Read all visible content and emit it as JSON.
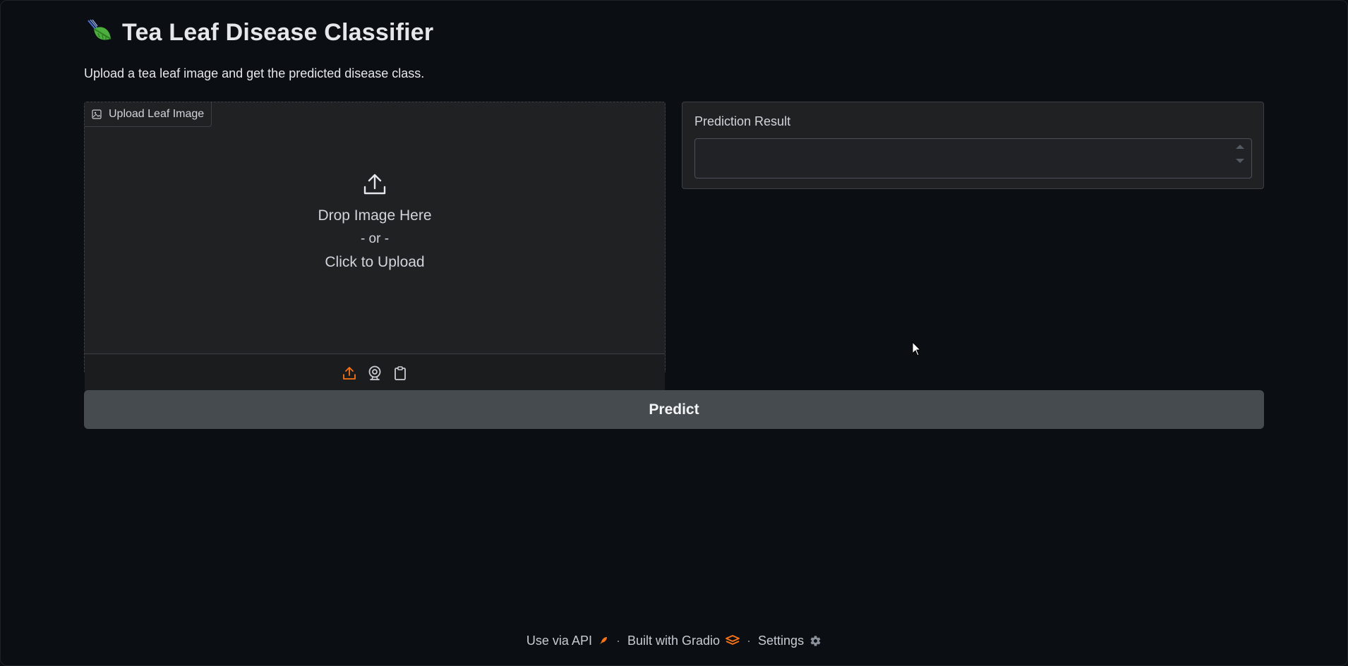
{
  "app": {
    "title": "Tea Leaf Disease Classifier",
    "subtitle": "Upload a tea leaf image and get the predicted disease class.",
    "logo_icon": "tea-leaf-icon"
  },
  "upload": {
    "label": "Upload Leaf Image",
    "label_icon": "image-icon",
    "drop_text": "Drop Image Here",
    "or_text": "- or -",
    "click_text": "Click to Upload",
    "sources": [
      "upload-icon",
      "webcam-icon",
      "clipboard-icon"
    ],
    "active_source": "upload-icon"
  },
  "result": {
    "label": "Prediction Result",
    "value": ""
  },
  "predict": {
    "label": "Predict"
  },
  "footer": {
    "api_label": "Use via API",
    "built_label": "Built with Gradio",
    "settings_label": "Settings",
    "separator": "·"
  },
  "colors": {
    "background": "#0b0f13",
    "panel": "#1f2123",
    "button": "#464b4f",
    "accent": "#f97316"
  }
}
